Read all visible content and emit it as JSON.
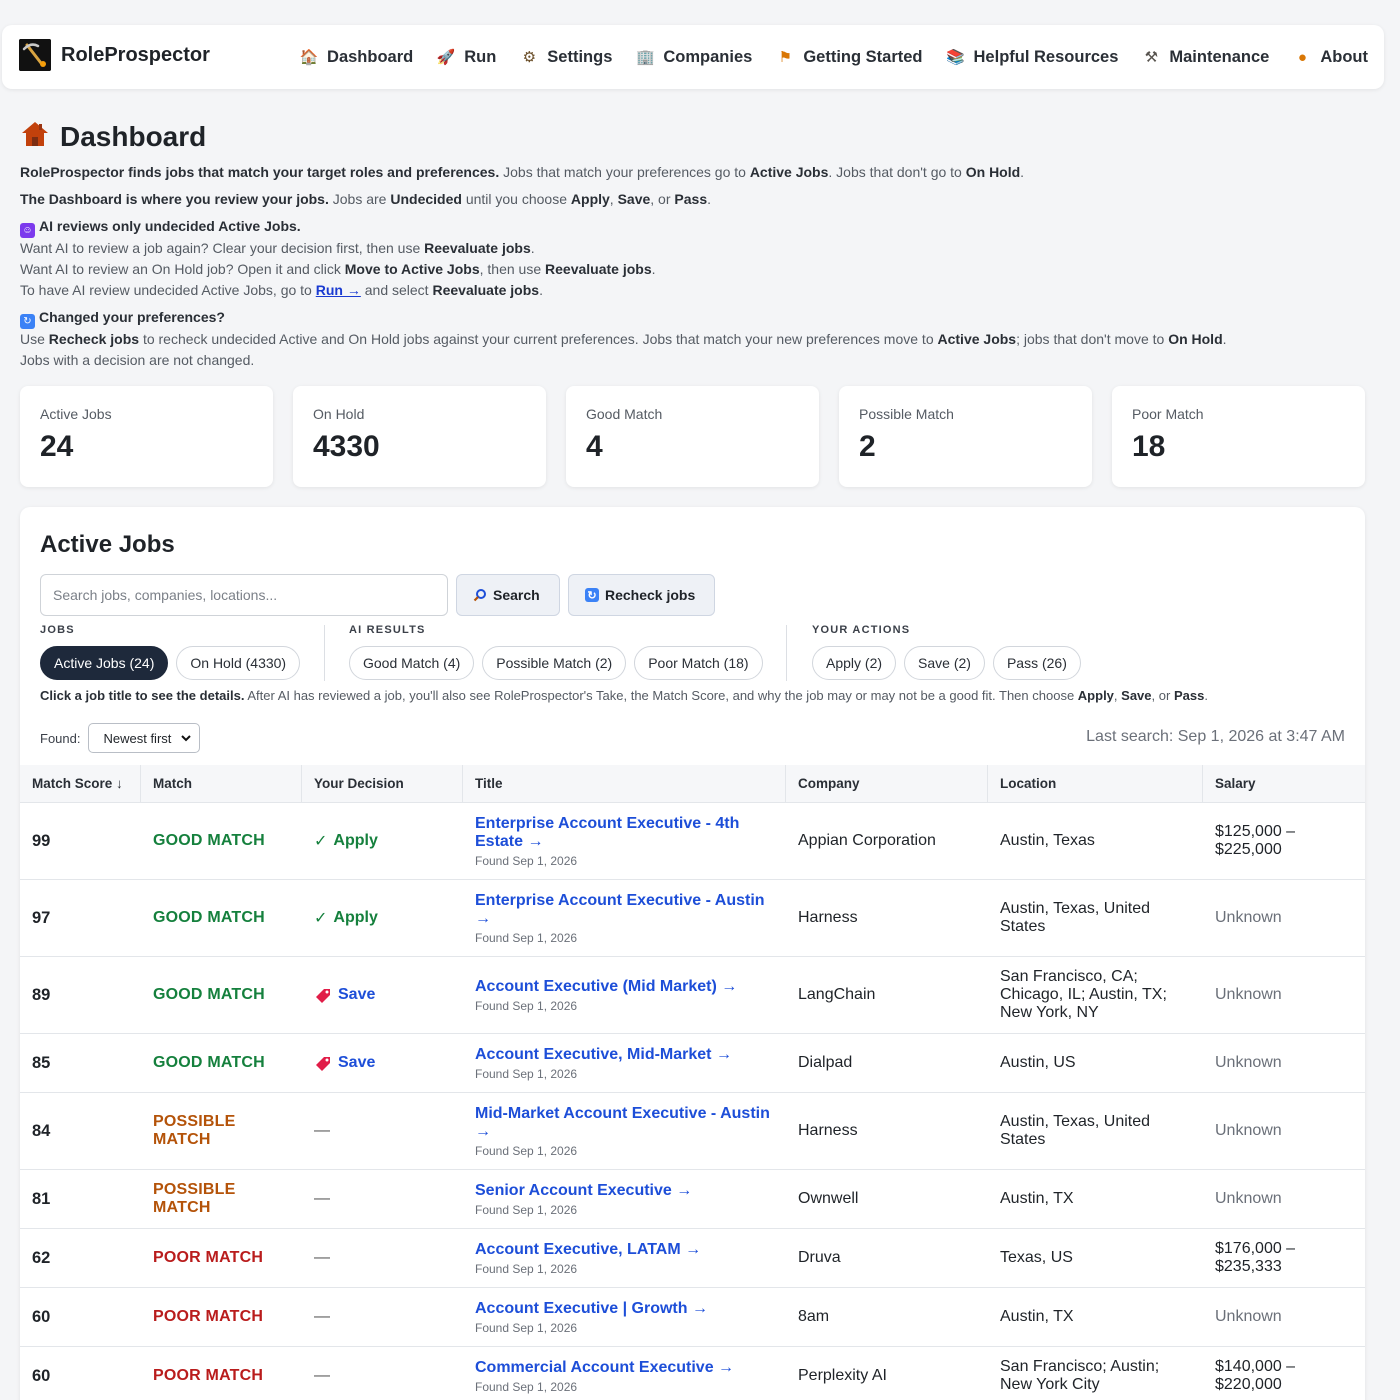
{
  "app": {
    "name": "RoleProspector"
  },
  "nav": [
    {
      "label": "Dashboard",
      "icon": "house-icon",
      "symbol": "🏠"
    },
    {
      "label": "Run",
      "icon": "rocket-icon",
      "symbol": "🚀"
    },
    {
      "label": "Settings",
      "icon": "gear-icon",
      "symbol": "⚙"
    },
    {
      "label": "Companies",
      "icon": "building-icon",
      "symbol": "🏢"
    },
    {
      "label": "Getting Started",
      "icon": "signpost-icon",
      "symbol": "⚑"
    },
    {
      "label": "Helpful Resources",
      "icon": "books-icon",
      "symbol": "📚"
    },
    {
      "label": "Maintenance",
      "icon": "tools-icon",
      "symbol": "⚒"
    },
    {
      "label": "About",
      "icon": "nugget-icon",
      "symbol": "●"
    }
  ],
  "page": {
    "title": "Dashboard",
    "intro": {
      "p1_b": "RoleProspector finds jobs that match your target roles and preferences.",
      "p1_a": " Jobs that match your preferences go to ",
      "p1_b2": "Active Jobs",
      "p1_c": ". Jobs that don't go to ",
      "p1_b3": "On Hold",
      "p1_d": ".",
      "p2_b": "The Dashboard is where you review your jobs.",
      "p2_a": " Jobs are ",
      "p2_b2": "Undecided",
      "p2_c": " until you choose ",
      "p2_b3": "Apply",
      "p2_d": ", ",
      "p2_b4": "Save",
      "p2_e": ", or ",
      "p2_b5": "Pass",
      "p2_f": ".",
      "ai_head": "AI reviews only undecided Active Jobs.",
      "ai_l1_a": "Want AI to review a job again? Clear your decision first, then use ",
      "ai_l1_b": "Reevaluate jobs",
      "ai_l1_c": ".",
      "ai_l2_a": "Want AI to review an On Hold job? Open it and click ",
      "ai_l2_b": "Move to Active Jobs",
      "ai_l2_c": ", then use ",
      "ai_l2_d": "Reevaluate jobs",
      "ai_l2_e": ".",
      "ai_l3_a": "To have AI review undecided Active Jobs, go to ",
      "ai_l3_link": "Run →",
      "ai_l3_b": " and select ",
      "ai_l3_c": "Reevaluate jobs",
      "ai_l3_d": ".",
      "pref_head": "Changed your preferences?",
      "pref_l1_a": "Use ",
      "pref_l1_b": "Recheck jobs",
      "pref_l1_c": " to recheck undecided Active and On Hold jobs against your current preferences. Jobs that match your new preferences move to ",
      "pref_l1_d": "Active Jobs",
      "pref_l1_e": "; jobs that don't move to ",
      "pref_l1_f": "On Hold",
      "pref_l1_g": ".",
      "pref_l2": "Jobs with a decision are not changed."
    }
  },
  "stats": [
    {
      "label": "Active Jobs",
      "value": "24"
    },
    {
      "label": "On Hold",
      "value": "4330"
    },
    {
      "label": "Good Match",
      "value": "4"
    },
    {
      "label": "Possible Match",
      "value": "2"
    },
    {
      "label": "Poor Match",
      "value": "18"
    }
  ],
  "panel": {
    "title": "Active Jobs",
    "search_placeholder": "Search jobs, companies, locations...",
    "search_button": "Search",
    "recheck_button": "Recheck jobs",
    "groups": {
      "jobs_label": "JOBS",
      "jobs": [
        "Active Jobs (24)",
        "On Hold (4330)"
      ],
      "ai_label": "AI RESULTS",
      "ai": [
        "Good Match (4)",
        "Possible Match (2)",
        "Poor Match (18)"
      ],
      "actions_label": "YOUR ACTIONS",
      "actions": [
        "Apply (2)",
        "Save (2)",
        "Pass (26)"
      ]
    },
    "help_b": "Click a job title to see the details.",
    "help_a": " After AI has reviewed a job, you'll also see RoleProspector's Take, the Match Score, and why the job may or may not be a good fit. Then choose ",
    "help_b2": "Apply",
    "help_c": ", ",
    "help_b3": "Save",
    "help_d": ", or ",
    "help_b4": "Pass",
    "help_e": ".",
    "found_label": "Found:",
    "sort_value": "Newest first",
    "last_search": "Last search: Sep 1, 2026 at 3:47 AM"
  },
  "colors": {
    "good": "#15803d",
    "possible": "#b45309",
    "poor": "#b91c1c",
    "apply": "#15803d",
    "save": "#1d4ed8",
    "link": "#1d4ed8"
  },
  "table": {
    "headers": [
      "Match Score ↓",
      "Match",
      "Your Decision",
      "Title",
      "Company",
      "Location",
      "Salary"
    ],
    "rows": [
      {
        "score": "99",
        "match": "GOOD MATCH",
        "level": "good",
        "decision": "Apply",
        "title": "Enterprise Account Executive - 4th Estate →",
        "found": "Found Sep 1, 2026",
        "company": "Appian Corporation",
        "location": "Austin, Texas",
        "salary": "$125,000 – $225,000"
      },
      {
        "score": "97",
        "match": "GOOD MATCH",
        "level": "good",
        "decision": "Apply",
        "title": "Enterprise Account Executive - Austin →",
        "found": "Found Sep 1, 2026",
        "company": "Harness",
        "location": "Austin, Texas, United States",
        "salary": "Unknown"
      },
      {
        "score": "89",
        "match": "GOOD MATCH",
        "level": "good",
        "decision": "Save",
        "title": "Account Executive (Mid Market) →",
        "found": "Found Sep 1, 2026",
        "company": "LangChain",
        "location": "San Francisco, CA; Chicago, IL; Austin, TX; New York, NY",
        "salary": "Unknown"
      },
      {
        "score": "85",
        "match": "GOOD MATCH",
        "level": "good",
        "decision": "Save",
        "title": "Account Executive, Mid-Market →",
        "found": "Found Sep 1, 2026",
        "company": "Dialpad",
        "location": "Austin, US",
        "salary": "Unknown"
      },
      {
        "score": "84",
        "match": "POSSIBLE MATCH",
        "level": "possible",
        "decision": "—",
        "title": "Mid-Market Account Executive - Austin →",
        "found": "Found Sep 1, 2026",
        "company": "Harness",
        "location": "Austin, Texas, United States",
        "salary": "Unknown"
      },
      {
        "score": "81",
        "match": "POSSIBLE MATCH",
        "level": "possible",
        "decision": "—",
        "title": "Senior Account Executive →",
        "found": "Found Sep 1, 2026",
        "company": "Ownwell",
        "location": "Austin, TX",
        "salary": "Unknown"
      },
      {
        "score": "62",
        "match": "POOR MATCH",
        "level": "poor",
        "decision": "—",
        "title": "Account Executive, LATAM →",
        "found": "Found Sep 1, 2026",
        "company": "Druva",
        "location": "Texas, US",
        "salary": "$176,000 – $235,333"
      },
      {
        "score": "60",
        "match": "POOR MATCH",
        "level": "poor",
        "decision": "—",
        "title": "Account Executive | Growth →",
        "found": "Found Sep 1, 2026",
        "company": "8am",
        "location": "Austin, TX",
        "salary": "Unknown"
      },
      {
        "score": "60",
        "match": "POOR MATCH",
        "level": "poor",
        "decision": "—",
        "title": "Commercial Account Executive →",
        "found": "Found Sep 1, 2026",
        "company": "Perplexity AI",
        "location": "San Francisco; Austin; New York City",
        "salary": "$140,000 – $220,000"
      }
    ]
  }
}
